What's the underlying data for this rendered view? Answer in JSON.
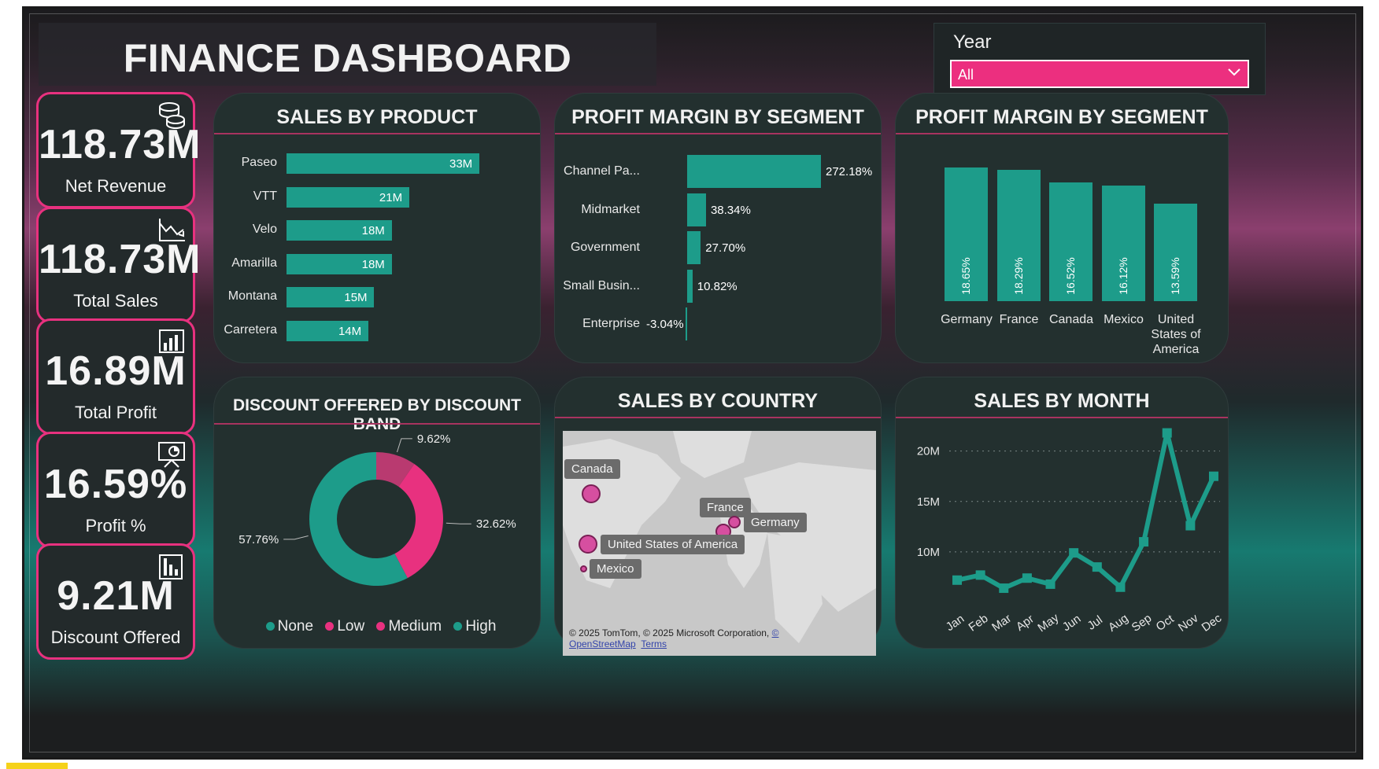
{
  "header": {
    "title": "FINANCE DASHBOARD"
  },
  "filter": {
    "label": "Year",
    "selected": "All"
  },
  "kpis": [
    {
      "value": "118.73M",
      "label": "Net Revenue",
      "icon": "coins-icon"
    },
    {
      "value": "118.73M",
      "label": "Total Sales",
      "icon": "trend-chart-icon"
    },
    {
      "value": "16.89M",
      "label": "Total Profit",
      "icon": "bar-chart-icon"
    },
    {
      "value": "16.59%",
      "label": "Profit %",
      "icon": "presentation-icon"
    },
    {
      "value": "9.21M",
      "label": "Discount Offered",
      "icon": "report-icon"
    }
  ],
  "cards": {
    "sales_by_product": "SALES BY PRODUCT",
    "profit_margin_segment": "PROFIT MARGIN  BY SEGMENT",
    "profit_margin_country": "PROFIT MARGIN BY SEGMENT",
    "discount_band": "DISCOUNT OFFERED BY DISCOUNT BAND",
    "sales_by_country": "SALES BY COUNTRY",
    "sales_by_month": "SALES BY MONTH"
  },
  "map": {
    "labels": [
      "Canada",
      "France",
      "Germany",
      "United States of America",
      "Mexico"
    ],
    "attribution": "© 2025 TomTom, © 2025 Microsoft Corporation, ",
    "osm": "© OpenStreetMap",
    "terms": "Terms"
  },
  "colors": {
    "accent": "#e8317f",
    "teal": "#1d9c8a",
    "card": "#23302f"
  },
  "chart_data": [
    {
      "type": "bar",
      "orientation": "horizontal",
      "title": "SALES BY PRODUCT",
      "categories": [
        "Paseo",
        "VTT",
        "Velo",
        "Amarilla",
        "Montana",
        "Carretera"
      ],
      "values": [
        33,
        21,
        18,
        18,
        15,
        14
      ],
      "value_labels": [
        "33M",
        "21M",
        "18M",
        "18M",
        "15M",
        "14M"
      ],
      "unit": "M"
    },
    {
      "type": "bar",
      "orientation": "horizontal",
      "title": "PROFIT MARGIN  BY SEGMENT",
      "categories": [
        "Channel Pa...",
        "Midmarket",
        "Government",
        "Small Busin...",
        "Enterprise"
      ],
      "values": [
        272.18,
        38.34,
        27.7,
        10.82,
        -3.04
      ],
      "value_labels": [
        "272.18%",
        "38.34%",
        "27.70%",
        "10.82%",
        "-3.04%"
      ]
    },
    {
      "type": "bar",
      "orientation": "vertical",
      "title": "PROFIT MARGIN BY SEGMENT",
      "categories": [
        "Germany",
        "France",
        "Canada",
        "Mexico",
        "United States of America"
      ],
      "values": [
        18.65,
        18.29,
        16.52,
        16.12,
        13.59
      ],
      "value_labels": [
        "18.65%",
        "18.29%",
        "16.52%",
        "16.12%",
        "13.59%"
      ]
    },
    {
      "type": "pie",
      "donut": true,
      "title": "DISCOUNT OFFERED BY DISCOUNT BAND",
      "legend": [
        "None",
        "Low",
        "Medium",
        "High"
      ],
      "legend_colors": [
        "#1d9c8a",
        "#e8317f",
        "#e8317f",
        "#1d9c8a"
      ],
      "slices": [
        {
          "value": 57.76,
          "label": "57.76%",
          "color": "#1d9c8a"
        },
        {
          "value": 32.62,
          "label": "32.62%",
          "color": "#e8317f"
        },
        {
          "value": 9.62,
          "label": "9.62%",
          "color": "#b93a70"
        }
      ]
    },
    {
      "type": "line",
      "title": "SALES BY MONTH",
      "categories": [
        "Jan",
        "Feb",
        "Mar",
        "Apr",
        "May",
        "Jun",
        "Jul",
        "Aug",
        "Sep",
        "Oct",
        "Nov",
        "Dec"
      ],
      "values": [
        7.2,
        7.7,
        6.4,
        7.4,
        6.8,
        9.9,
        8.5,
        6.5,
        11.0,
        21.8,
        12.6,
        17.5
      ],
      "yticks": [
        "20M",
        "15M",
        "10M"
      ],
      "ytick_values": [
        20,
        15,
        10
      ],
      "ylim": [
        5,
        22
      ],
      "grid": true
    }
  ]
}
